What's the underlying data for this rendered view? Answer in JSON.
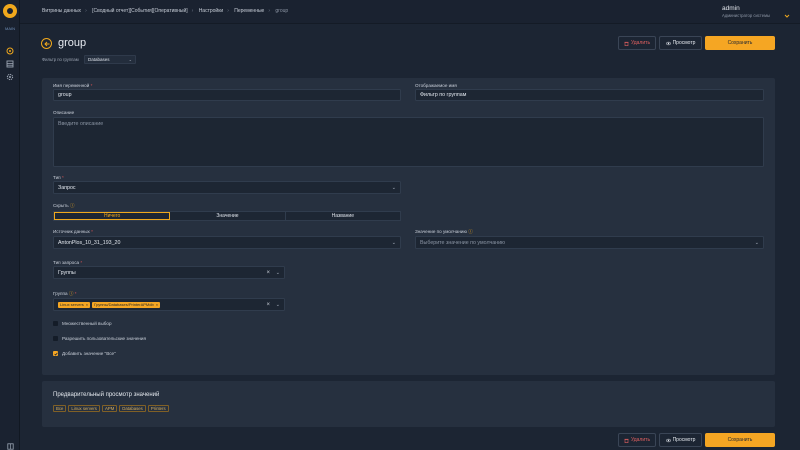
{
  "app": {
    "section_tag": "MAIN"
  },
  "breadcrumb": [
    "Витрины данных",
    "[Сводный отчет][События][Оперативный]",
    "Настройки",
    "Переменные",
    "group"
  ],
  "user": {
    "name": "admin",
    "role": "Администратор системы"
  },
  "page": {
    "title": "group"
  },
  "actions": {
    "delete": "Удалить",
    "preview": "Просмотр",
    "save": "Сохранить"
  },
  "filter": {
    "label": "Фильтр по группам",
    "value": "Databases"
  },
  "form": {
    "var_name": {
      "label": "Имя переменной",
      "value": "group"
    },
    "display_name": {
      "label": "Отображаемое имя",
      "value": "Фильтр по группам"
    },
    "description": {
      "label": "Описание",
      "placeholder": "Введите описание"
    },
    "type": {
      "label": "Тип",
      "value": "Запрос"
    },
    "hide": {
      "label": "Скрыть",
      "options": [
        "Ничего",
        "Значение",
        "Название"
      ],
      "selected": "Ничего"
    },
    "datasource": {
      "label": "Источник данных",
      "value": "AntonPlos_10_31_193_20"
    },
    "default_value": {
      "label": "Значение по умолчанию",
      "placeholder": "Выберите значение по умолчанию"
    },
    "query_type": {
      "label": "Тип запроса",
      "value": "Группы"
    },
    "group": {
      "label": "Группа",
      "tags": [
        "Linux servers",
        "Группы/Databases/PrinterAPMdb"
      ]
    },
    "multi_select": {
      "label": "Множественный выбор",
      "checked": false
    },
    "custom_values": {
      "label": "Разрешить пользовательские значения",
      "checked": false
    },
    "include_all": {
      "label": "Добавить значение \"Все\"",
      "checked": true
    }
  },
  "preview": {
    "title": "Предварительный просмотр значений",
    "values": [
      "Все",
      "Linux servers",
      "APM",
      "Databases",
      "Printers"
    ]
  }
}
